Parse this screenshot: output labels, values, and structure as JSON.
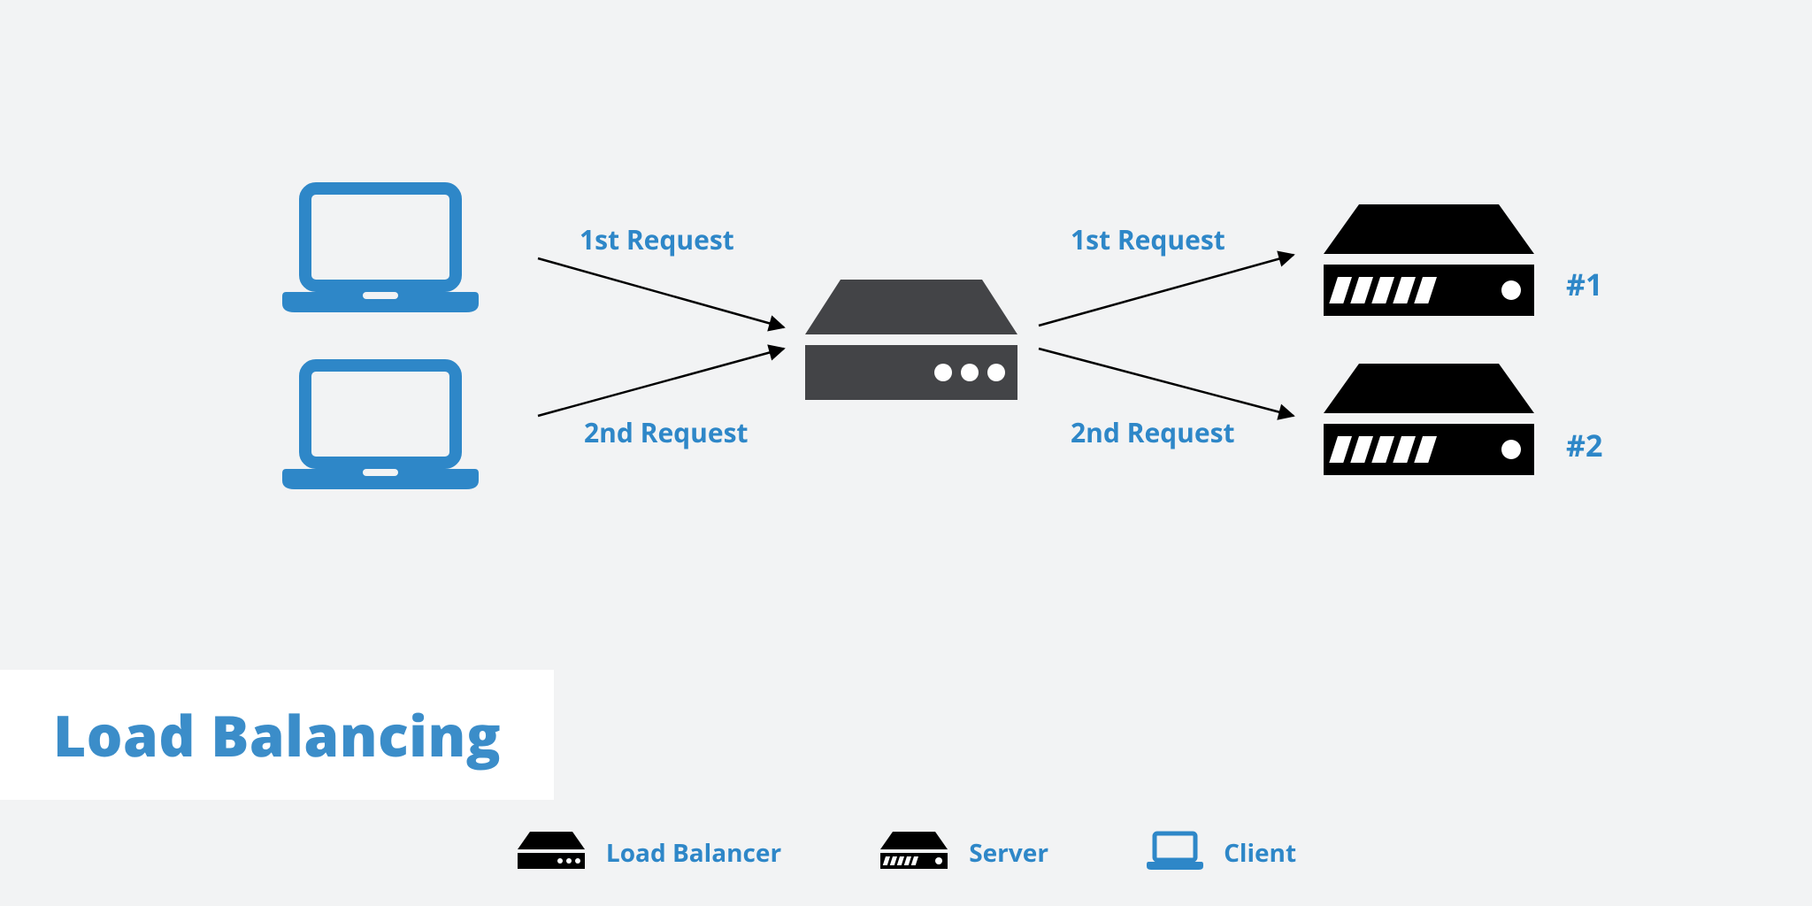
{
  "title": "Load Balancing",
  "labels": {
    "req1_left": "1st Request",
    "req2_left": "2nd Request",
    "req1_right": "1st Request",
    "req2_right": "2nd Request",
    "server1": "#1",
    "server2": "#2"
  },
  "legend": {
    "lb": "Load Balancer",
    "server": "Server",
    "client": "Client"
  },
  "colors": {
    "accent": "#2e87c8",
    "lb": "#434447",
    "server": "#000000",
    "bg": "#f2f3f4"
  }
}
